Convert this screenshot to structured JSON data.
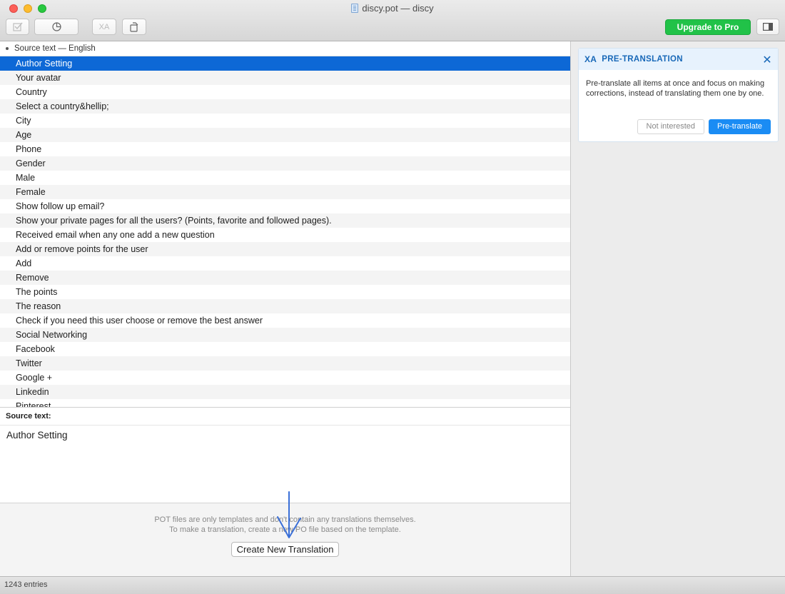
{
  "window": {
    "title": "discy.pot — discy"
  },
  "toolbar": {
    "upgrade_label": "Upgrade to Pro",
    "translate_icon": "XA"
  },
  "list": {
    "column_header": "Source text — English",
    "rows": [
      "Author Setting",
      "Your avatar",
      "Country",
      "Select a country&hellip;",
      "City",
      "Age",
      "Phone",
      "Gender",
      "Male",
      "Female",
      "Show follow up email?",
      "Show your private pages for all the users? (Points, favorite and followed pages).",
      "Received email when any one add a new question",
      "Add or remove points for the user",
      "Add",
      "Remove",
      "The points",
      "The reason",
      "Check if you need this user choose or remove the best answer",
      "Social Networking",
      "Facebook",
      "Twitter",
      "Google +",
      "Linkedin",
      "Pinterest"
    ]
  },
  "source": {
    "header": "Source text:",
    "value": "Author Setting"
  },
  "notice": {
    "line1": "POT files are only templates and don't contain any translations themselves.",
    "line2": "To make a translation, create a new PO file based on the template.",
    "button": "Create New Translation"
  },
  "status": {
    "entries": "1243 entries"
  },
  "pretranslation": {
    "title": "PRE-TRANSLATION",
    "body": "Pre-translate all items at once and focus on making corrections, instead of translating them one by one.",
    "not_interested": "Not interested",
    "pretranslate": "Pre-translate"
  }
}
